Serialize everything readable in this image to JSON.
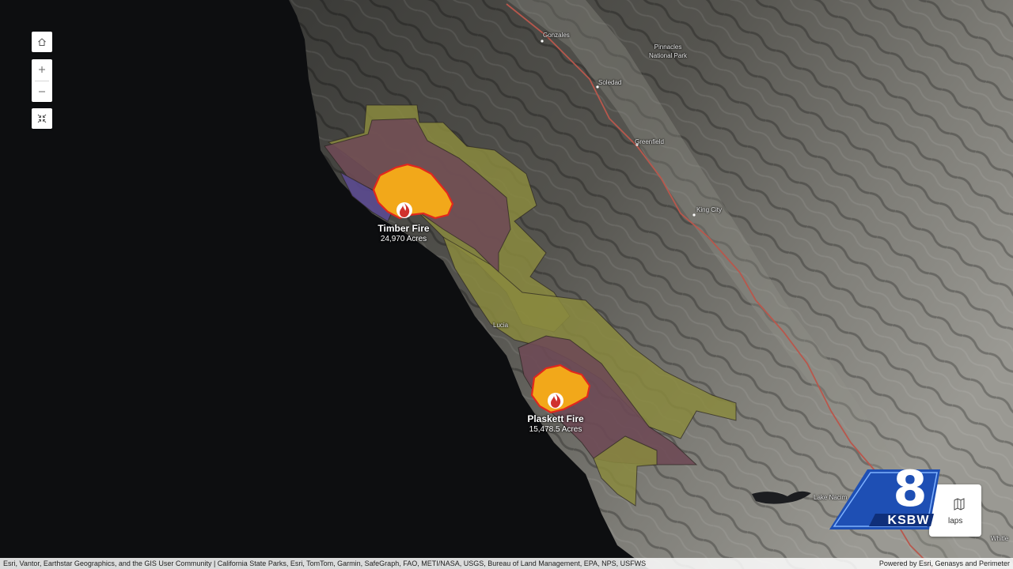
{
  "map": {
    "places": {
      "gonzales": "Gonzales",
      "pinnacles": "Pinnacles\nNational Park",
      "soledad": "Soledad",
      "greenfield": "Greenfield",
      "king_city": "King City",
      "lucia": "Lucia",
      "lake_nacimiento": "Lake Nacim",
      "whitley": "Whitle"
    },
    "fires": [
      {
        "name": "Timber Fire",
        "acres": "24,970 Acres"
      },
      {
        "name": "Plaskett Fire",
        "acres": "15,478.5 Acres"
      }
    ],
    "colors": {
      "land_dark": "#3d3d3a",
      "land_light": "#8c8b86",
      "ocean": "#0d0e10",
      "zone_olive": "#8a8a3e",
      "zone_mauve": "#6e4a55",
      "zone_purple": "#5b4a90",
      "fire_fill": "#f2a81a",
      "fire_outline": "#e0281e",
      "road": "#b8574c"
    }
  },
  "controls": {
    "home_icon": "home-icon",
    "zoom_in_icon": "plus-icon",
    "zoom_out_icon": "minus-icon",
    "full_extent_icon": "collapse-icon"
  },
  "attribution": {
    "left": "Esri, Vantor, Earthstar Geographics, and the GIS User Community | California State Parks, Esri, TomTom, Garmin, SafeGraph, FAO, METI/NASA, USGS, Bureau of Land Management, EPA, NPS, USFWS",
    "right": "Powered by Esri, Genasys and Perimeter"
  },
  "overlay": {
    "maps_label": "laps",
    "logo_number": "8",
    "logo_text": "KSBW"
  }
}
